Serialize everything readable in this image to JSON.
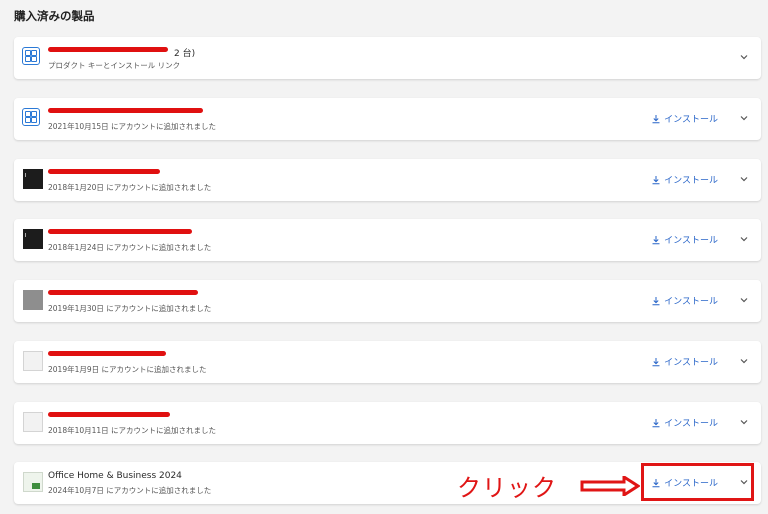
{
  "page": {
    "title": "購入済みの製品"
  },
  "products": [
    {
      "name": "2 台)",
      "subtitle": "プロダクト キーとインストール リンク",
      "install_label": "",
      "icon": "ms-store-icon"
    },
    {
      "name": "",
      "subtitle": "2021年10月15日 にアカウントに追加されました",
      "install_label": "インストール",
      "icon": "ms-store-icon"
    },
    {
      "name": "",
      "subtitle": "2018年1月20日 にアカウントに追加されました",
      "install_label": "インストール",
      "icon": "office-box-dark"
    },
    {
      "name": "",
      "subtitle": "2018年1月24日 にアカウントに追加されました",
      "install_label": "インストール",
      "icon": "office-box-dark"
    },
    {
      "name": "",
      "subtitle": "2019年1月30日 にアカウントに追加されました",
      "install_label": "インストール",
      "icon": "office-box-gray"
    },
    {
      "name": "",
      "subtitle": "2019年1月9日 にアカウントに追加されました",
      "install_label": "インストール",
      "icon": "office-box-light"
    },
    {
      "name": "",
      "subtitle": "2018年10月11日 にアカウントに追加されました",
      "install_label": "インストール",
      "icon": "office-box-light"
    },
    {
      "name": "Office Home & Business 2024",
      "subtitle": "2024年10月7日 にアカウントに追加されました",
      "install_label": "インストール",
      "icon": "office-box-green"
    }
  ],
  "annotation": {
    "text": "クリック",
    "color": "#e01515"
  },
  "colors": {
    "accent": "#2764c8",
    "redaction": "#e01010",
    "background": "#f3f3f3"
  }
}
